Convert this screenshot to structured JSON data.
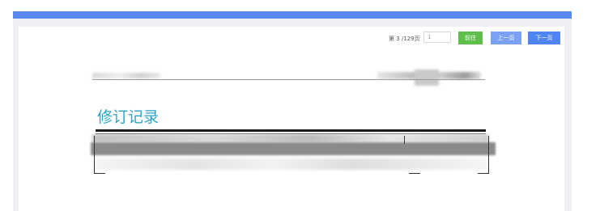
{
  "pager": {
    "info": "第 3 /129页",
    "input_value": "1",
    "go_label": "前往",
    "prev_label": "上一页",
    "next_label": "下一页"
  },
  "document": {
    "title": "修订记录"
  },
  "colors": {
    "topbar": "#5b87f2",
    "go_button": "#5fbf4b",
    "prev_button": "#7aa1f5",
    "next_button": "#4f84f3",
    "title": "#2ea3c7"
  }
}
